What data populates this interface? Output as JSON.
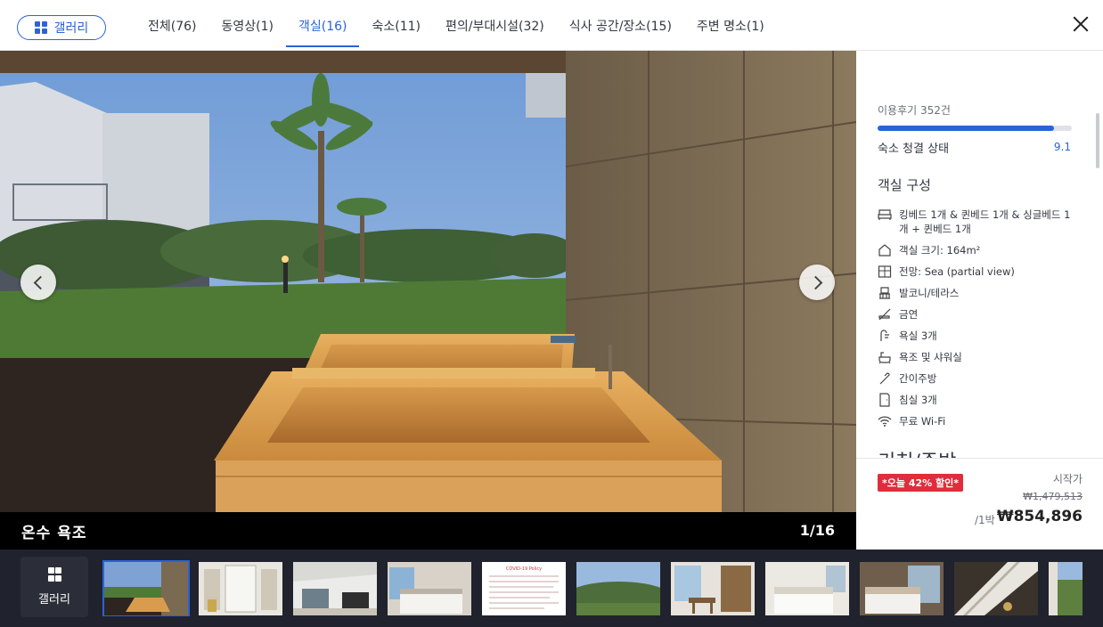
{
  "header": {
    "gallery_label": "갤러리",
    "tabs": [
      {
        "label": "전체(76)"
      },
      {
        "label": "동영상(1)"
      },
      {
        "label": "객실(16)"
      },
      {
        "label": "숙소(11)"
      },
      {
        "label": "편의/부대시설(32)"
      },
      {
        "label": "식사 공간/장소(15)"
      },
      {
        "label": "주변 명소(1)"
      }
    ],
    "active_tab": "객실(16)",
    "accent_color": "#2a63d8"
  },
  "photo": {
    "caption": "온수 욕조",
    "counter": "1/16"
  },
  "side": {
    "review_count": "이용후기 352건",
    "cleanliness_label": "숙소 청결 상태",
    "cleanliness_score": "9.1",
    "cleanliness_fill": 0.91,
    "room_section_title": "객실 구성",
    "amenities": [
      {
        "icon": "bed-icon",
        "text": "킹베드 1개 & 퀸베드 1개 & 싱글베드 1개 + 퀸베드 1개"
      },
      {
        "icon": "house-icon",
        "text": "객실 크기: 164m²"
      },
      {
        "icon": "window-view-icon",
        "text": "전망: Sea (partial view)"
      },
      {
        "icon": "balcony-icon",
        "text": "발코니/테라스"
      },
      {
        "icon": "no-smoking-icon",
        "text": "금연"
      },
      {
        "icon": "shower-icon",
        "text": "욕실 3개"
      },
      {
        "icon": "bathtub-icon",
        "text": "욕조 및 샤워실"
      },
      {
        "icon": "kitchen-icon",
        "text": "간이주방"
      },
      {
        "icon": "door-icon",
        "text": "침실 3개"
      },
      {
        "icon": "wifi-icon",
        "text": "무료 Wi-Fi"
      }
    ],
    "next_section_title": "키친/주방"
  },
  "price": {
    "discount_badge": "*오늘 42% 할인*",
    "from_label": "시작가",
    "original_price": "₩1,479,513",
    "per_night": "/1박",
    "current_price": "₩854,896",
    "badge_color": "#e12d3b"
  },
  "strip": {
    "gallery_label": "갤러리",
    "thumbnails": [
      {
        "name": "thumb-outdoor-bath",
        "selected": true
      },
      {
        "name": "thumb-hallway"
      },
      {
        "name": "thumb-living-room"
      },
      {
        "name": "thumb-bedroom-1"
      },
      {
        "name": "thumb-covid-notice",
        "text": "COVID-19 Policy"
      },
      {
        "name": "thumb-garden-view"
      },
      {
        "name": "thumb-dining-nook"
      },
      {
        "name": "thumb-bedroom-2"
      },
      {
        "name": "thumb-bedroom-3"
      },
      {
        "name": "thumb-staircase"
      },
      {
        "name": "thumb-balcony-partial"
      }
    ]
  }
}
